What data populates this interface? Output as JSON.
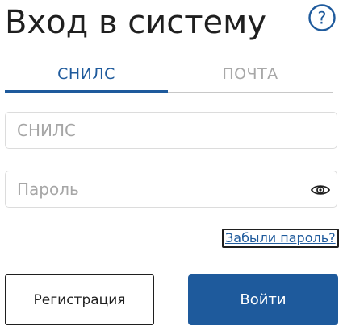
{
  "header": {
    "title": "Вход в систему",
    "help_icon": "question-circle-icon",
    "help_glyph": "?"
  },
  "tabs": [
    {
      "label": "СНИЛС",
      "active": true
    },
    {
      "label": "ПОЧТА",
      "active": false
    }
  ],
  "form": {
    "snils": {
      "placeholder": "СНИЛС",
      "value": ""
    },
    "password": {
      "placeholder": "Пароль",
      "value": "",
      "toggle_icon": "eye-icon"
    },
    "forgot_label": "Забыли пароль?"
  },
  "actions": {
    "register_label": "Регистрация",
    "login_label": "Войти"
  },
  "colors": {
    "accent": "#1e5a9c",
    "text": "#1f1f1f",
    "inactive_tab": "#a8a8a8",
    "border": "#dcdcdc"
  }
}
